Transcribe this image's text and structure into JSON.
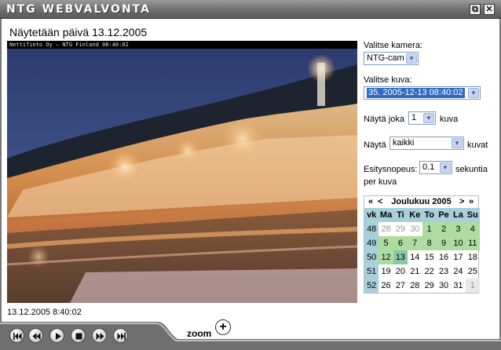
{
  "window": {
    "title": "NTG  WEBVALVONTA",
    "restore_glyph": "⧉",
    "close_glyph": "✕"
  },
  "header": {
    "showing_text": "Näytetään päivä 13.12.2005"
  },
  "camera_image": {
    "overlay_text": "NettiTieto Oy – NTG Finland 08:40:02",
    "timestamp": "13.12.2005 8:40:02"
  },
  "controls": {
    "camera_label": "Valitse kamera:",
    "camera_value": "NTG-cam",
    "image_label": "Valitse kuva:",
    "image_value": "35. 2005-12-13 08:40:02",
    "every_label": "Näytä joka",
    "every_value": "1",
    "every_suffix": "kuva",
    "show_label": "Näytä",
    "show_value": "kaikki",
    "show_suffix": "kuvat",
    "speed_label": "Esitysnopeus:",
    "speed_value": "0.1",
    "speed_suffix": "sekuntia",
    "speed_suffix2": "per kuva"
  },
  "calendar": {
    "prev_year": "«",
    "prev_month": "<",
    "month_title": "Joulukuu 2005",
    "next_month": ">",
    "next_year": "»",
    "headers": [
      "vk",
      "Ma",
      "Ti",
      "Ke",
      "To",
      "Pe",
      "La",
      "Su"
    ],
    "weeks": [
      {
        "wk": "48",
        "days": [
          "28",
          "29",
          "30",
          "1",
          "2",
          "3",
          "4"
        ]
      },
      {
        "wk": "49",
        "days": [
          "5",
          "6",
          "7",
          "8",
          "9",
          "10",
          "11"
        ]
      },
      {
        "wk": "50",
        "days": [
          "12",
          "13",
          "14",
          "15",
          "16",
          "17",
          "18"
        ]
      },
      {
        "wk": "51",
        "days": [
          "19",
          "20",
          "21",
          "22",
          "23",
          "24",
          "25"
        ]
      },
      {
        "wk": "52",
        "days": [
          "26",
          "27",
          "28",
          "29",
          "30",
          "31",
          "1"
        ]
      }
    ]
  },
  "player": {
    "zoom_label": "zoom",
    "zoom_glyph": "+"
  },
  "colors": {
    "calendar_header": "#a7d0db",
    "calendar_image_day": "#aedca0",
    "selected_option": "#316ac5"
  }
}
